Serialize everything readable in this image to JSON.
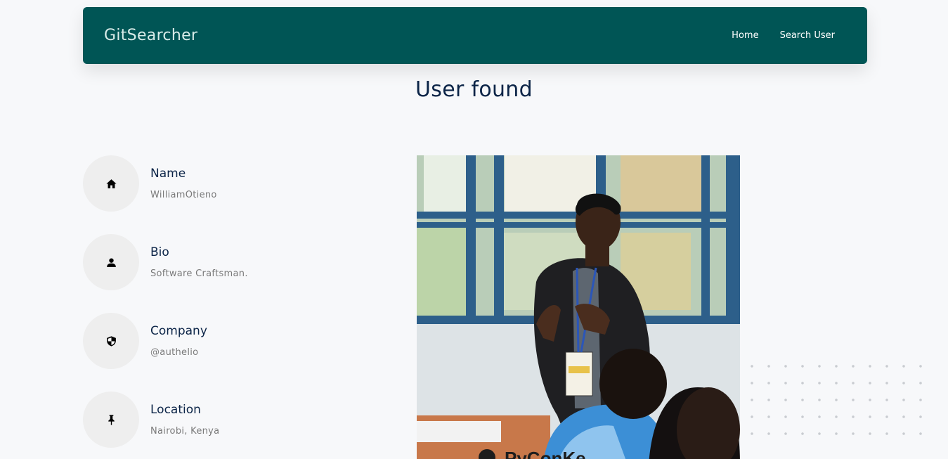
{
  "app": {
    "brand": "GitSearcher",
    "nav": [
      {
        "label": "Home"
      },
      {
        "label": "Search User"
      }
    ]
  },
  "page": {
    "title": "User found"
  },
  "profile": {
    "fields": [
      {
        "label": "Name",
        "value": "WilliamOtieno",
        "icon": "home-icon"
      },
      {
        "label": "Bio",
        "value": "Software Craftsman.",
        "icon": "user-icon"
      },
      {
        "label": "Company",
        "value": "@authelio",
        "icon": "shield-icon"
      },
      {
        "label": "Location",
        "value": "Nairobi, Kenya",
        "icon": "pin-icon"
      }
    ],
    "photo": {
      "banner_text": "PyConKe"
    }
  },
  "colors": {
    "navbar": "#005555",
    "heading": "#0b2447",
    "muted": "#7a7a7a",
    "background": "#f7f8fa"
  }
}
